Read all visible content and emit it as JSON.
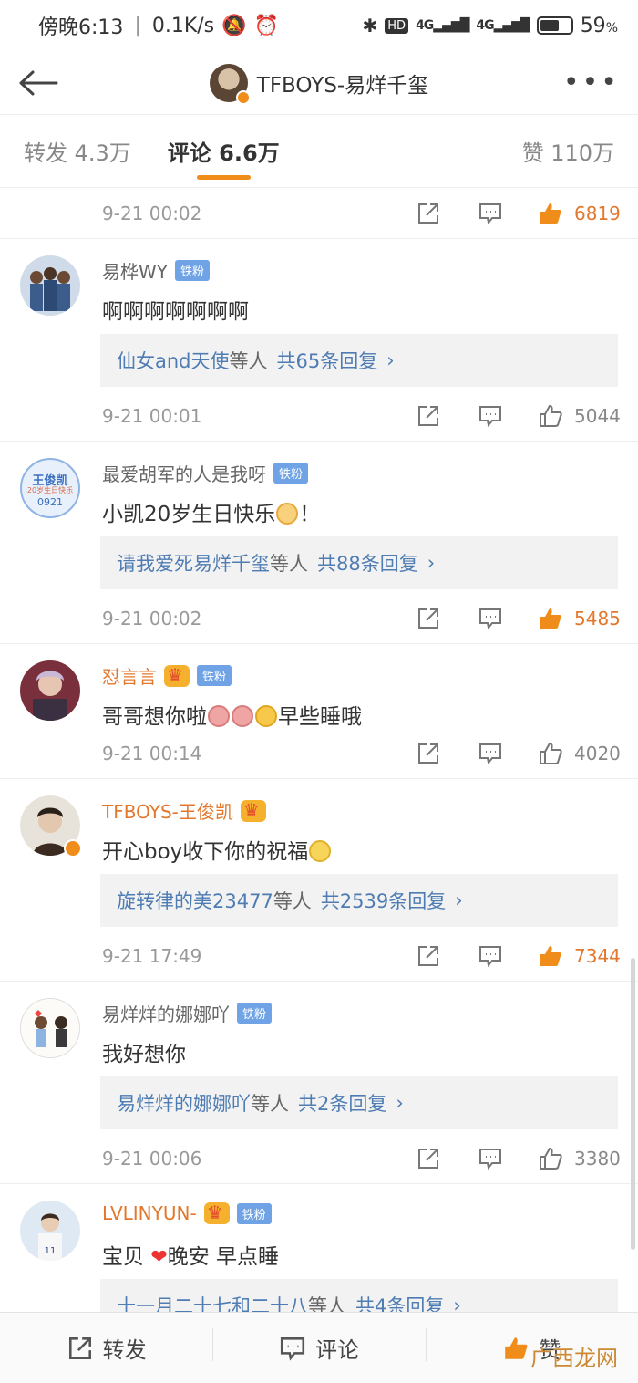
{
  "status_bar": {
    "time": "傍晚6:13",
    "speed": "0.1K/s",
    "network1": "4G",
    "network2": "4G",
    "battery": "59"
  },
  "nav": {
    "title": "TFBOYS-易烊千玺"
  },
  "tabs": {
    "repost": "转发 4.3万",
    "comments": "评论 6.6万",
    "likes": "赞 110万"
  },
  "first_item": {
    "time": "9-21 00:02",
    "likes": "6819"
  },
  "comments": [
    {
      "name": "易桦WY",
      "badge": "铁粉",
      "text": "啊啊啊啊啊啊啊",
      "reply_users": "仙女and天使",
      "reply_mid": "等人",
      "reply_count": "共65条回复",
      "time": "9-21 00:01",
      "likes": "5044"
    },
    {
      "name": "最爱胡军的人是我呀",
      "badge": "铁粉",
      "text_before": "小凯20岁生日快乐",
      "text_after": "！",
      "avatar_line1": "王俊凯",
      "avatar_line2": "20岁生日快乐",
      "avatar_line3": "0921",
      "reply_users": "请我爱死易烊千玺",
      "reply_mid": "等人",
      "reply_count": "共88条回复",
      "time": "9-21 00:02",
      "likes": "5485"
    },
    {
      "name": "怼言言",
      "badge": "铁粉",
      "text_before": "哥哥想你啦",
      "text_after": "早些睡哦",
      "time": "9-21 00:14",
      "likes": "4020"
    },
    {
      "name": "TFBOYS-王俊凯",
      "text_before": "开心boy收下你的祝福",
      "reply_users": "旋转律的美23477",
      "reply_mid": "等人",
      "reply_count": "共2539条回复",
      "time": "9-21 17:49",
      "likes": "7344"
    },
    {
      "name": "易烊烊的娜娜吖",
      "badge": "铁粉",
      "text": "我好想你",
      "reply_users": "易烊烊的娜娜吖",
      "reply_mid": "等人",
      "reply_count": "共2条回复",
      "time": "9-21 00:06",
      "likes": "3380"
    },
    {
      "name": "LVLINYUN-",
      "badge": "铁粉",
      "text_before": "宝贝",
      "text_after": "晚安 早点睡",
      "reply_users": "十一月二十七和二十八",
      "reply_mid": "等人",
      "reply_count": "共4条回复"
    }
  ],
  "toolbar": {
    "repost": "转发",
    "comment": "评论",
    "like": "赞"
  },
  "watermark": "广西龙网",
  "colors": {
    "accent": "#f08c1a",
    "link": "#4e7cb3",
    "liked": "#e3782d"
  }
}
